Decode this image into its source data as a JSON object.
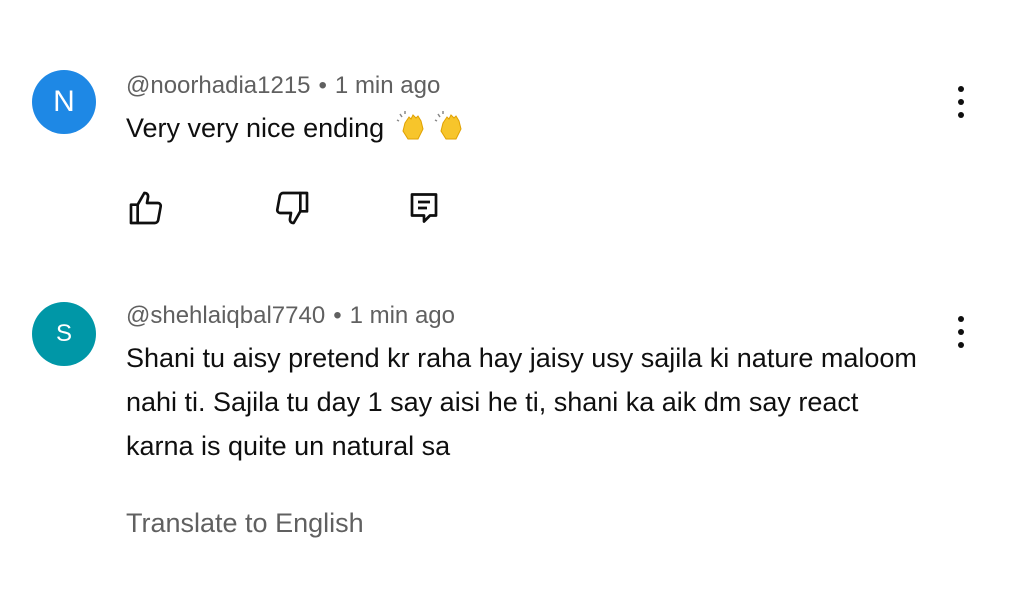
{
  "comments": [
    {
      "avatar_letter": "N",
      "avatar_color": "#1e88e5",
      "author": "@noorhadia1215",
      "separator": "•",
      "time": "1 min ago",
      "text": "Very very nice ending",
      "emoji": [
        "clapping-hands-icon",
        "clapping-hands-icon"
      ],
      "actions": [
        "like-icon",
        "dislike-icon",
        "reply-icon"
      ]
    },
    {
      "avatar_letter": "S",
      "avatar_color": "#0097a7",
      "author": "@shehlaiqbal7740",
      "separator": "•",
      "time": "1 min ago",
      "text": "Shani tu aisy pretend kr raha hay jaisy usy sajila ki nature maloom nahi ti. Sajila tu day 1 say aisi he ti, shani ka aik dm say react karna is quite un natural sa",
      "translate_label": "Translate to English"
    }
  ]
}
